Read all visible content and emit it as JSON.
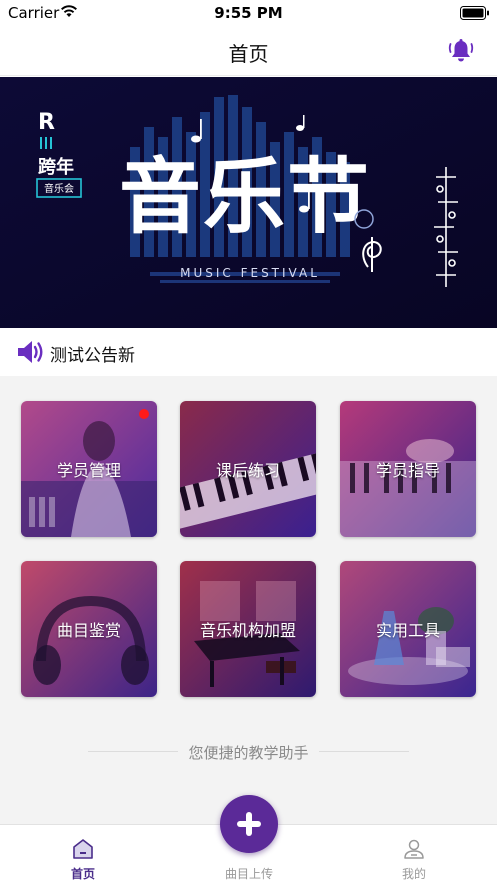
{
  "status_bar": {
    "carrier": "Carrier",
    "time": "9:55 PM",
    "wifi_icon": "wifi-icon",
    "battery_icon": "battery-icon"
  },
  "nav": {
    "title": "首页",
    "bell_icon": "bell-icon",
    "accent_color": "#6a2ec0"
  },
  "banner": {
    "brand_mark": "R",
    "side_text": "跨年",
    "tag_text": "音乐会",
    "main_title": "音乐节",
    "subtitle": "MUSIC FESTIVAL"
  },
  "notice": {
    "icon": "speaker-icon",
    "text": "测试公告新"
  },
  "cards": [
    {
      "label": "学员管理",
      "icon": "student-management",
      "has_badge": true
    },
    {
      "label": "课后练习",
      "icon": "after-class-practice",
      "has_badge": false
    },
    {
      "label": "学员指导",
      "icon": "student-guidance",
      "has_badge": false
    },
    {
      "label": "曲目鉴赏",
      "icon": "repertoire-appreciation",
      "has_badge": false
    },
    {
      "label": "音乐机构加盟",
      "icon": "institution-franchise",
      "has_badge": false
    },
    {
      "label": "实用工具",
      "icon": "practical-tools",
      "has_badge": false
    }
  ],
  "tagline": "您便捷的教学助手",
  "tab_bar": {
    "items": [
      {
        "label": "首页",
        "icon": "home-icon",
        "active": true
      },
      {
        "label": "曲目上传",
        "icon": "plus-icon",
        "active": false
      },
      {
        "label": "我的",
        "icon": "profile-icon",
        "active": false
      }
    ],
    "active_color": "#4a2d8a",
    "fab_color": "#5b2a98"
  }
}
